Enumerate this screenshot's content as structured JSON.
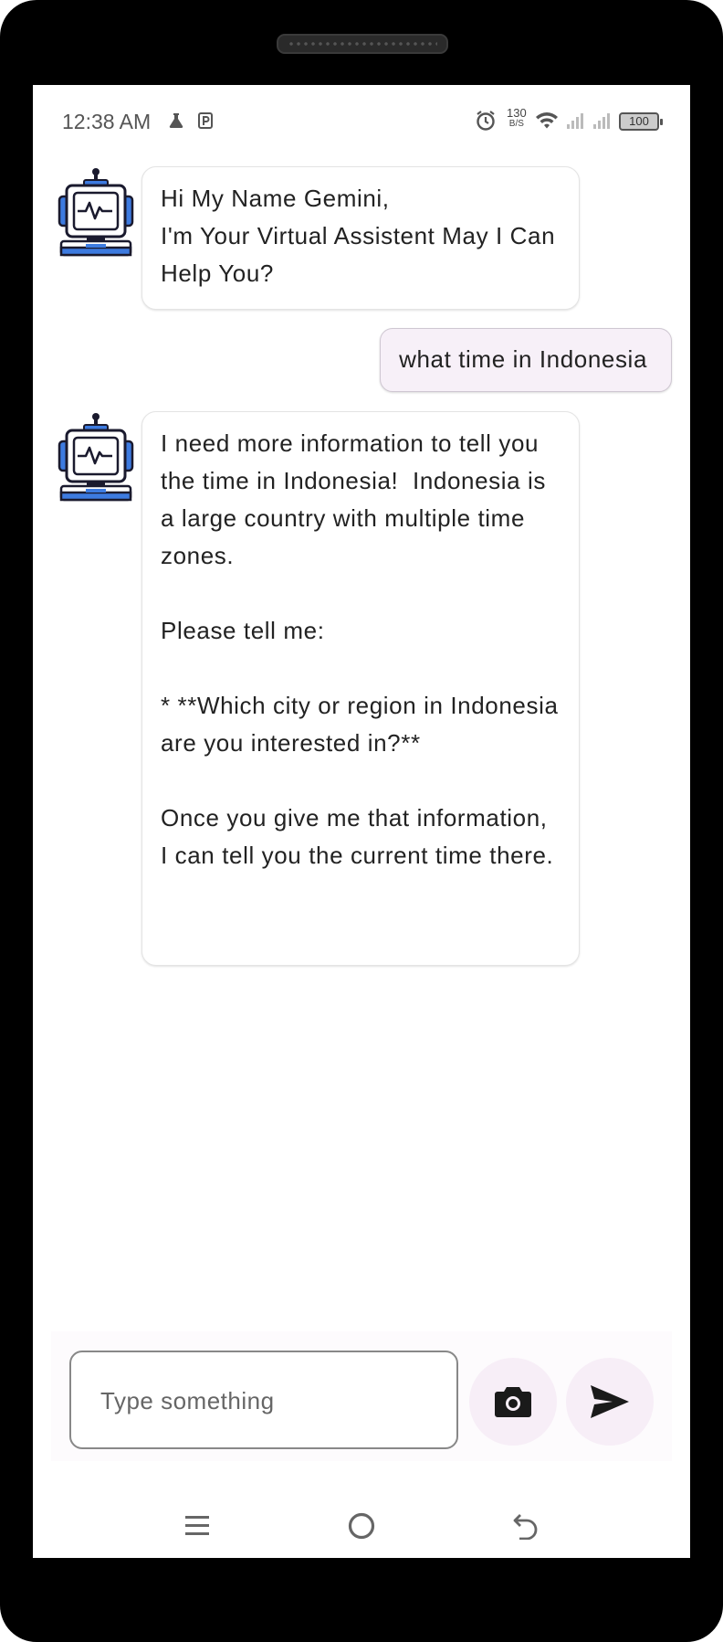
{
  "status_bar": {
    "time": "12:38 AM",
    "net_speed_value": "130",
    "net_speed_unit": "B/S",
    "battery": "100"
  },
  "messages": [
    {
      "role": "bot",
      "text": "Hi My Name Gemini,\nI'm Your Virtual Assistent May I Can Help You?"
    },
    {
      "role": "user",
      "text": "what time in Indonesia"
    },
    {
      "role": "bot",
      "text": "I need more information to tell you the time in Indonesia!  Indonesia is a large country with multiple time zones. \n\nPlease tell me:\n\n* **Which city or region in Indonesia are you interested in?** \n\nOnce you give me that information, I can tell you the current time there. \n"
    }
  ],
  "composer": {
    "placeholder": "Type something",
    "value": ""
  },
  "icons": {
    "avatar": "robot-icon",
    "camera": "camera-icon",
    "send": "send-icon",
    "nav_menu": "menu-icon",
    "nav_home": "home-icon",
    "nav_back": "back-icon"
  },
  "colors": {
    "user_bubble_bg": "#f7f0f8",
    "action_button_bg": "#f7eef7",
    "robot_blue": "#3d7be0"
  }
}
